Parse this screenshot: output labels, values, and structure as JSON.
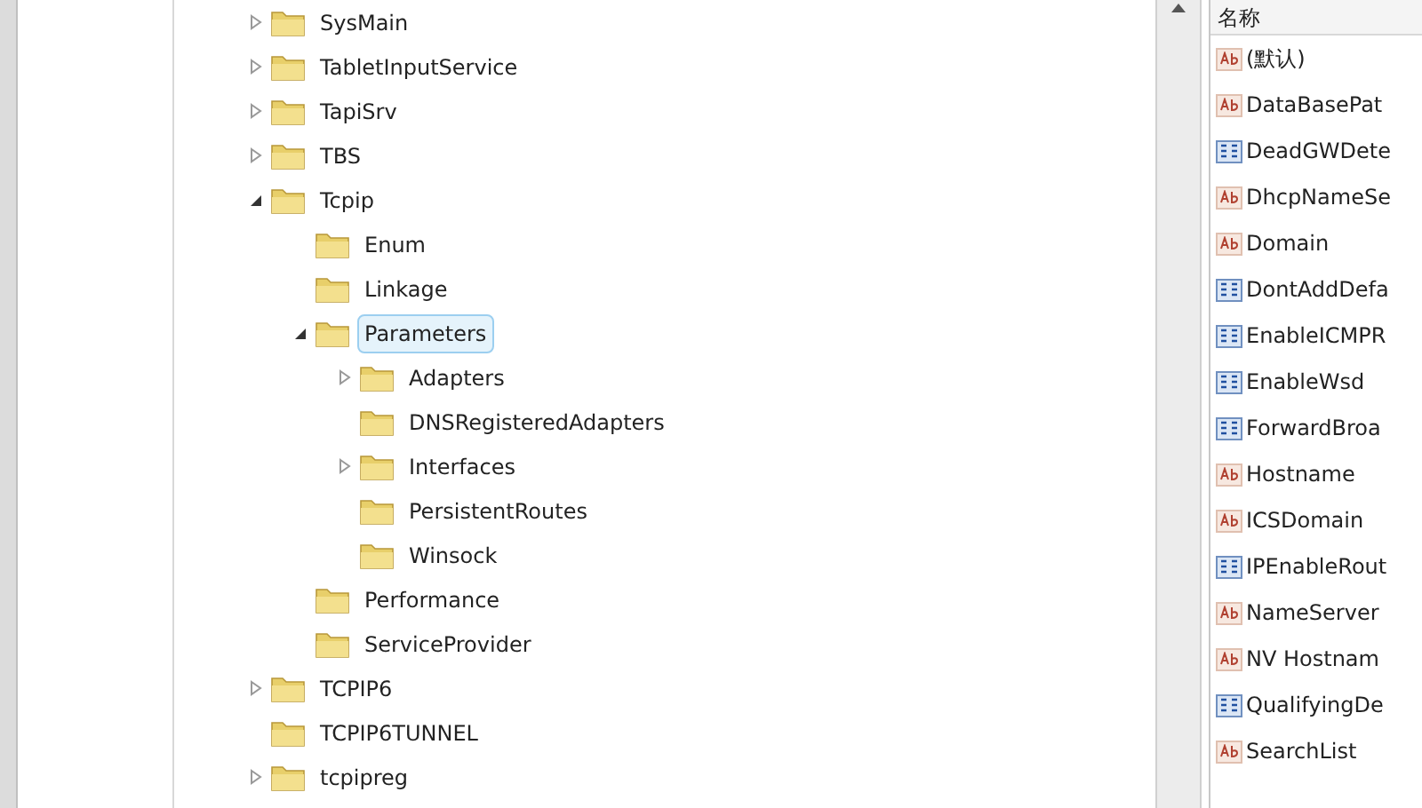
{
  "tree": [
    {
      "label": "SysMain",
      "expanded": false,
      "selected": false
    },
    {
      "label": "TabletInputService",
      "expanded": false,
      "selected": false
    },
    {
      "label": "TapiSrv",
      "expanded": false,
      "selected": false
    },
    {
      "label": "TBS",
      "expanded": false,
      "selected": false
    },
    {
      "label": "Tcpip",
      "expanded": true,
      "selected": false,
      "children": [
        {
          "label": "Enum",
          "selected": false
        },
        {
          "label": "Linkage",
          "selected": false
        },
        {
          "label": "Parameters",
          "expanded": true,
          "selected": true,
          "children": [
            {
              "label": "Adapters",
              "expanded": false,
              "selected": false
            },
            {
              "label": "DNSRegisteredAdapters",
              "selected": false
            },
            {
              "label": "Interfaces",
              "expanded": false,
              "selected": false
            },
            {
              "label": "PersistentRoutes",
              "selected": false
            },
            {
              "label": "Winsock",
              "selected": false
            }
          ]
        },
        {
          "label": "Performance",
          "selected": false
        },
        {
          "label": "ServiceProvider",
          "selected": false
        }
      ]
    },
    {
      "label": "TCPIP6",
      "expanded": false,
      "selected": false
    },
    {
      "label": "TCPIP6TUNNEL",
      "selected": false
    },
    {
      "label": "tcpipreg",
      "expanded": false,
      "selected": false
    }
  ],
  "values": {
    "column_header": "名称",
    "rows": [
      {
        "kind": "string",
        "name": "(默认)"
      },
      {
        "kind": "string",
        "name": "DataBasePat"
      },
      {
        "kind": "binary",
        "name": "DeadGWDete"
      },
      {
        "kind": "string",
        "name": "DhcpNameSe"
      },
      {
        "kind": "string",
        "name": "Domain"
      },
      {
        "kind": "binary",
        "name": "DontAddDefa"
      },
      {
        "kind": "binary",
        "name": "EnableICMPR"
      },
      {
        "kind": "binary",
        "name": "EnableWsd"
      },
      {
        "kind": "binary",
        "name": "ForwardBroa"
      },
      {
        "kind": "string",
        "name": "Hostname"
      },
      {
        "kind": "string",
        "name": "ICSDomain"
      },
      {
        "kind": "binary",
        "name": "IPEnableRout"
      },
      {
        "kind": "string",
        "name": "NameServer"
      },
      {
        "kind": "string",
        "name": "NV Hostnam"
      },
      {
        "kind": "binary",
        "name": "QualifyingDe"
      },
      {
        "kind": "string",
        "name": "SearchList"
      }
    ]
  }
}
